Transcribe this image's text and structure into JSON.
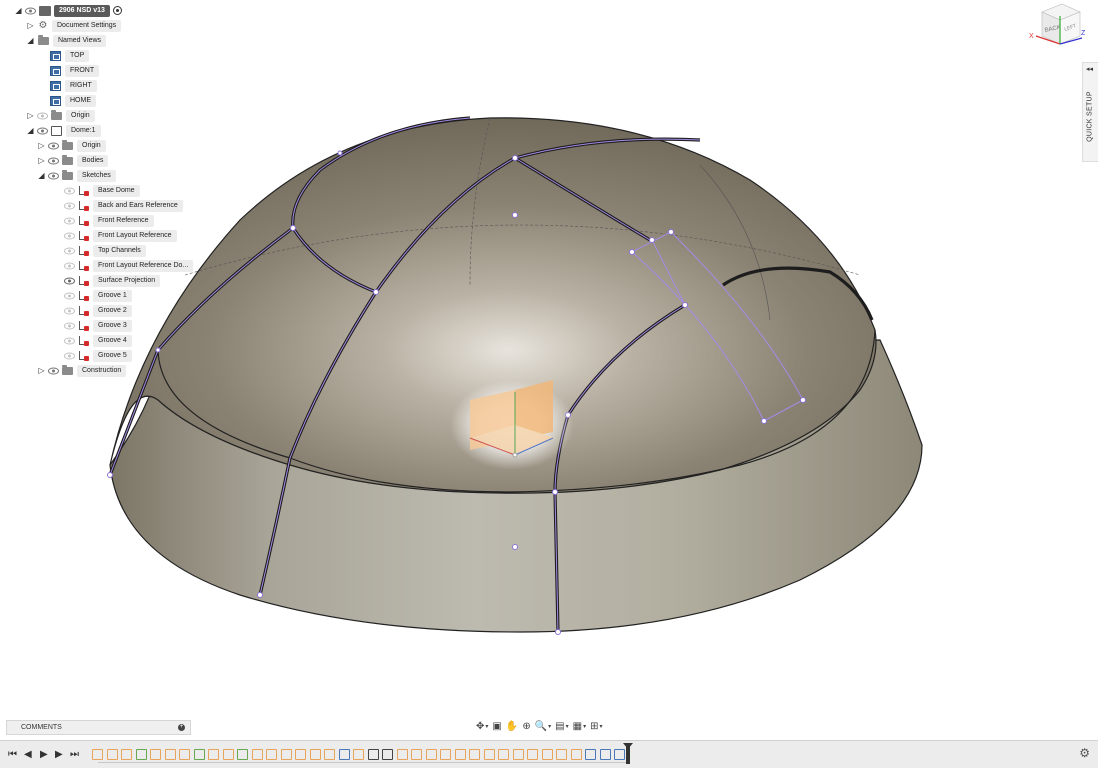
{
  "browser": {
    "document": {
      "title": "2906 NSD v13"
    },
    "document_settings": "Document Settings",
    "named_views": {
      "label": "Named Views",
      "items": [
        "TOP",
        "FRONT",
        "RIGHT",
        "HOME"
      ]
    },
    "origin": "Origin",
    "component": {
      "label": "Dome:1",
      "origin": "Origin",
      "bodies": "Bodies",
      "sketches": {
        "label": "Sketches",
        "items": [
          "Base Dome",
          "Back and Ears Reference",
          "Front Reference",
          "Front Layout Reference",
          "Top Channels",
          "Front Layout Reference Do...",
          "Surface Projection",
          "Groove 1",
          "Groove 2",
          "Groove 3",
          "Groove 4",
          "Groove 5"
        ]
      },
      "construction": "Construction"
    }
  },
  "viewcube": {
    "face_back": "BACK",
    "face_left": "LEFT",
    "axis_x": "X",
    "axis_z": "Z"
  },
  "quick_setup": {
    "label": "QUICK SETUP",
    "arrow": "◂◂"
  },
  "comments": {
    "label": "COMMENTS",
    "add": "+"
  },
  "colors": {
    "sketch_line": "#a48be6",
    "body_fill": "#8e8676",
    "timeline_bg": "#ececec"
  },
  "timeline": {
    "buttons": {
      "first": "⏮",
      "prev": "◀",
      "play": "▶",
      "next": "▶",
      "last": "⏭"
    },
    "settings_icon": "gear-icon"
  }
}
